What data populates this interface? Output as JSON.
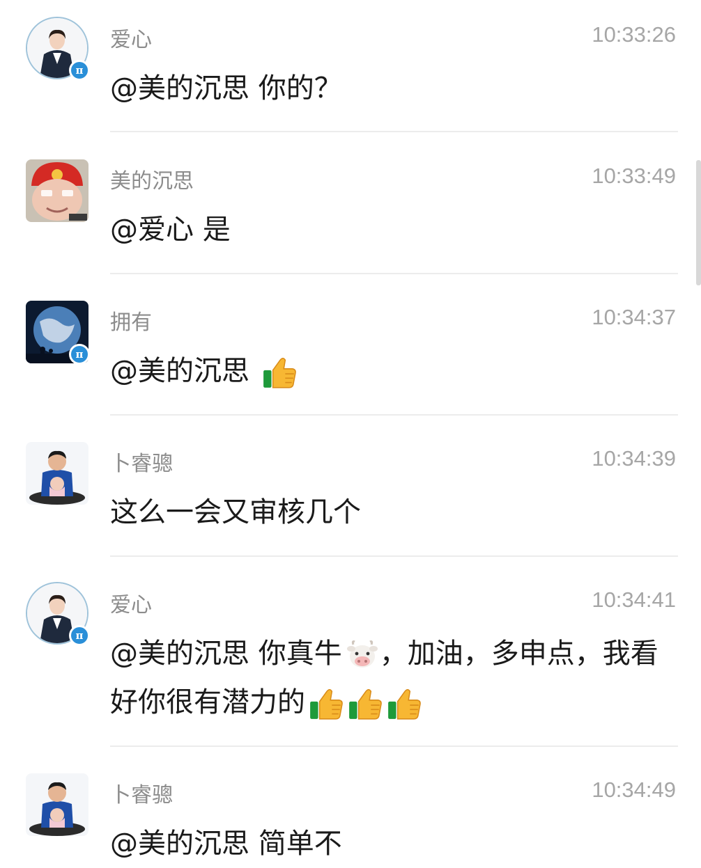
{
  "messages": [
    {
      "sender": "爱心",
      "time": "10:33:26",
      "text": "@美的沉思 你的？",
      "emoji": []
    },
    {
      "sender": "美的沉思",
      "time": "10:33:49",
      "text": "@爱心 是",
      "emoji": []
    },
    {
      "sender": "拥有",
      "time": "10:34:37",
      "text": "@美的沉思 ",
      "emoji": [
        "thumbs-up"
      ]
    },
    {
      "sender": "卜睿骢",
      "time": "10:34:39",
      "text": "这么一会又审核几个",
      "emoji": []
    },
    {
      "sender": "爱心",
      "time": "10:34:41",
      "text": "@美的沉思 你真牛",
      "text2": "，加油，多申点，我看好你很有潜力的",
      "emoji": [
        "cow-face",
        "thumbs-up",
        "thumbs-up",
        "thumbs-up"
      ]
    },
    {
      "sender": "卜睿骢",
      "time": "10:34:49",
      "text": "@美的沉思 简单不",
      "emoji": []
    }
  ],
  "badge_glyph": "π",
  "colors": {
    "badge": "#2a8fd8",
    "divider": "#ececec",
    "sender": "#8c8c8c",
    "time": "#a6a6a6"
  }
}
